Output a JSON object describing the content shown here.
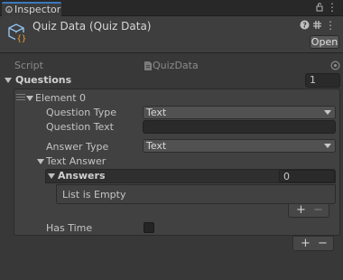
{
  "tab": {
    "label": "Inspector"
  },
  "header": {
    "title": "Quiz Data (Quiz Data)",
    "open_label": "Open"
  },
  "script": {
    "label": "Script",
    "value": "QuizData"
  },
  "questions": {
    "label": "Questions",
    "count": "1"
  },
  "element": {
    "label": "Element 0",
    "question_type_label": "Question Type",
    "question_type_value": "Text",
    "question_text_label": "Question Text",
    "question_text_value": "",
    "answer_type_label": "Answer Type",
    "answer_type_value": "Text",
    "text_answer_label": "Text Answer",
    "answers_label": "Answers",
    "answers_count": "0",
    "empty_text": "List is Empty",
    "has_time_label": "Has Time"
  },
  "buttons": {
    "plus": "+",
    "minus": "−"
  },
  "colors": {
    "accent": "#3a79bb",
    "background": "#383838",
    "panel": "#414141"
  }
}
